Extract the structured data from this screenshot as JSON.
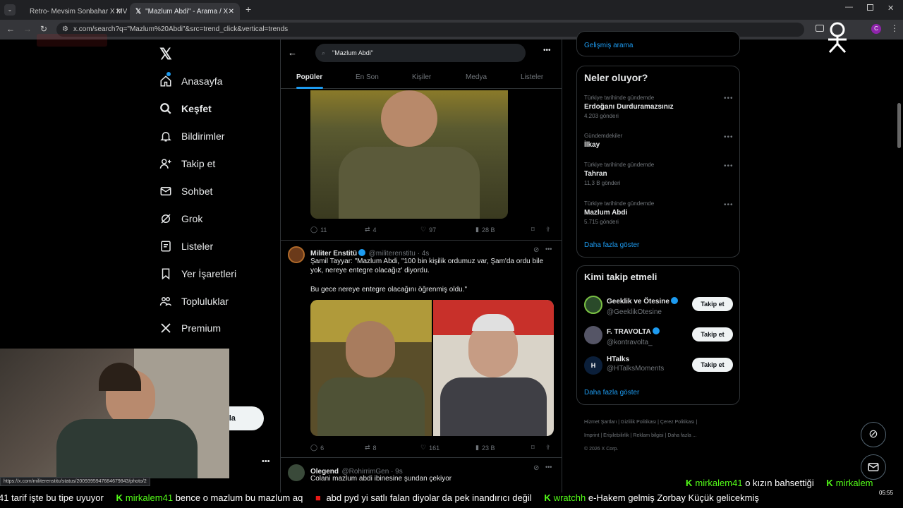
{
  "browser": {
    "tabs": [
      {
        "title": "Retro- Mevsim Sonbahar X MV..."
      },
      {
        "title": "\"Mazlum Abdi\" - Arama / X"
      }
    ],
    "url": "x.com/search?q=\"Mazlum%20Abdi\"&src=trend_click&vertical=trends",
    "status_url": "https://x.com/militerenstitu/status/2009395947684679843/photo/2"
  },
  "nav": {
    "items": [
      {
        "label": "Anasayfa",
        "icon": "home-icon"
      },
      {
        "label": "Keşfet",
        "icon": "search-icon"
      },
      {
        "label": "Bildirimler",
        "icon": "bell-icon"
      },
      {
        "label": "Takip et",
        "icon": "add-user-icon"
      },
      {
        "label": "Sohbet",
        "icon": "mail-icon"
      },
      {
        "label": "Grok",
        "icon": "grok-icon"
      },
      {
        "label": "Listeler",
        "icon": "list-icon"
      },
      {
        "label": "Yer İşaretleri",
        "icon": "bookmark-icon"
      },
      {
        "label": "Topluluklar",
        "icon": "communities-icon"
      },
      {
        "label": "Premium",
        "icon": "x-logo-icon"
      }
    ],
    "post_button_partial": "nla"
  },
  "search": {
    "query": "\"Mazlum Abdi\"",
    "tabs": [
      "Popüler",
      "En Son",
      "Kişiler",
      "Medya",
      "Listeler"
    ]
  },
  "tweets": [
    {
      "replies": "11",
      "reposts": "4",
      "likes": "97",
      "views": "28 B"
    },
    {
      "name": "Militer Enstitü",
      "handle": "@militerenstitu · 4s",
      "line1": "Şamil Tayyar: \"Mazlum Abdi, \"100 bin kişilik ordumuz var, Şam'da ordu bile",
      "line2": "yok, nereye entegre olacağız' diyordu.",
      "line3": "Bu gece nereye entegre olacağını öğrenmiş oldu.\"",
      "replies": "6",
      "reposts": "8",
      "likes": "161",
      "views": "23 B"
    },
    {
      "name": "Olegend",
      "handle": "@RohirrimGen · 9s",
      "text": "Colani mazlum abdi ibinesine şundan çekiyor"
    }
  ],
  "sidebar": {
    "advanced_search": "Gelişmiş arama",
    "trends_title": "Neler oluyor?",
    "trends": [
      {
        "meta": "Türkiye tarihinde gündemde",
        "name": "Erdoğanı Durduramazsınız",
        "count": "4.203 gönderi"
      },
      {
        "meta": "Gündemdekiler",
        "name": "İlkay",
        "count": ""
      },
      {
        "meta": "Türkiye tarihinde gündemde",
        "name": "Tahran",
        "count": "11,3 B gönderi"
      },
      {
        "meta": "Türkiye tarihinde gündemde",
        "name": "Mazlum Abdi",
        "count": "5.715 gönderi"
      }
    ],
    "show_more": "Daha fazla göster",
    "follow_title": "Kimi takip etmeli",
    "follow": [
      {
        "name": "Geeklik ve Ötesine",
        "handle": "@GeeklikOtesine",
        "button": "Takip et"
      },
      {
        "name": "F. TRAVOLTA",
        "handle": "@kontravolta_",
        "button": "Takip et"
      },
      {
        "name": "HTalks",
        "handle": "@HTalksMoments",
        "button": "Takip et"
      }
    ],
    "follow_more": "Daha fazla göster",
    "footer": [
      "Hizmet Şartları",
      "Gizlilik Politikası",
      "Çerez Politikası",
      "Imprint",
      "Erişilebilirlik",
      "Reklam bilgisi",
      "Daha fazla ...",
      "© 2026 X Corp."
    ]
  },
  "overlay": {
    "chat_user_top": "mirkalem41",
    "chat_text_top": "o kızın bahsettiği",
    "chat_user_top2": "mirkalem",
    "ticker": [
      {
        "user": "",
        "text": "41 tarif işte bu tipe uyuyor"
      },
      {
        "user": "mirkalem41",
        "text": "bence o mazlum bu mazlum aq"
      },
      {
        "user": "",
        "text": "abd pyd yi satlı falan diyolar da pek inandırıcı değil"
      },
      {
        "user": "wratchh",
        "text": "e-Hakem gelmiş Zorbay Küçük gelicekmiş"
      }
    ],
    "clock": "05:55"
  }
}
